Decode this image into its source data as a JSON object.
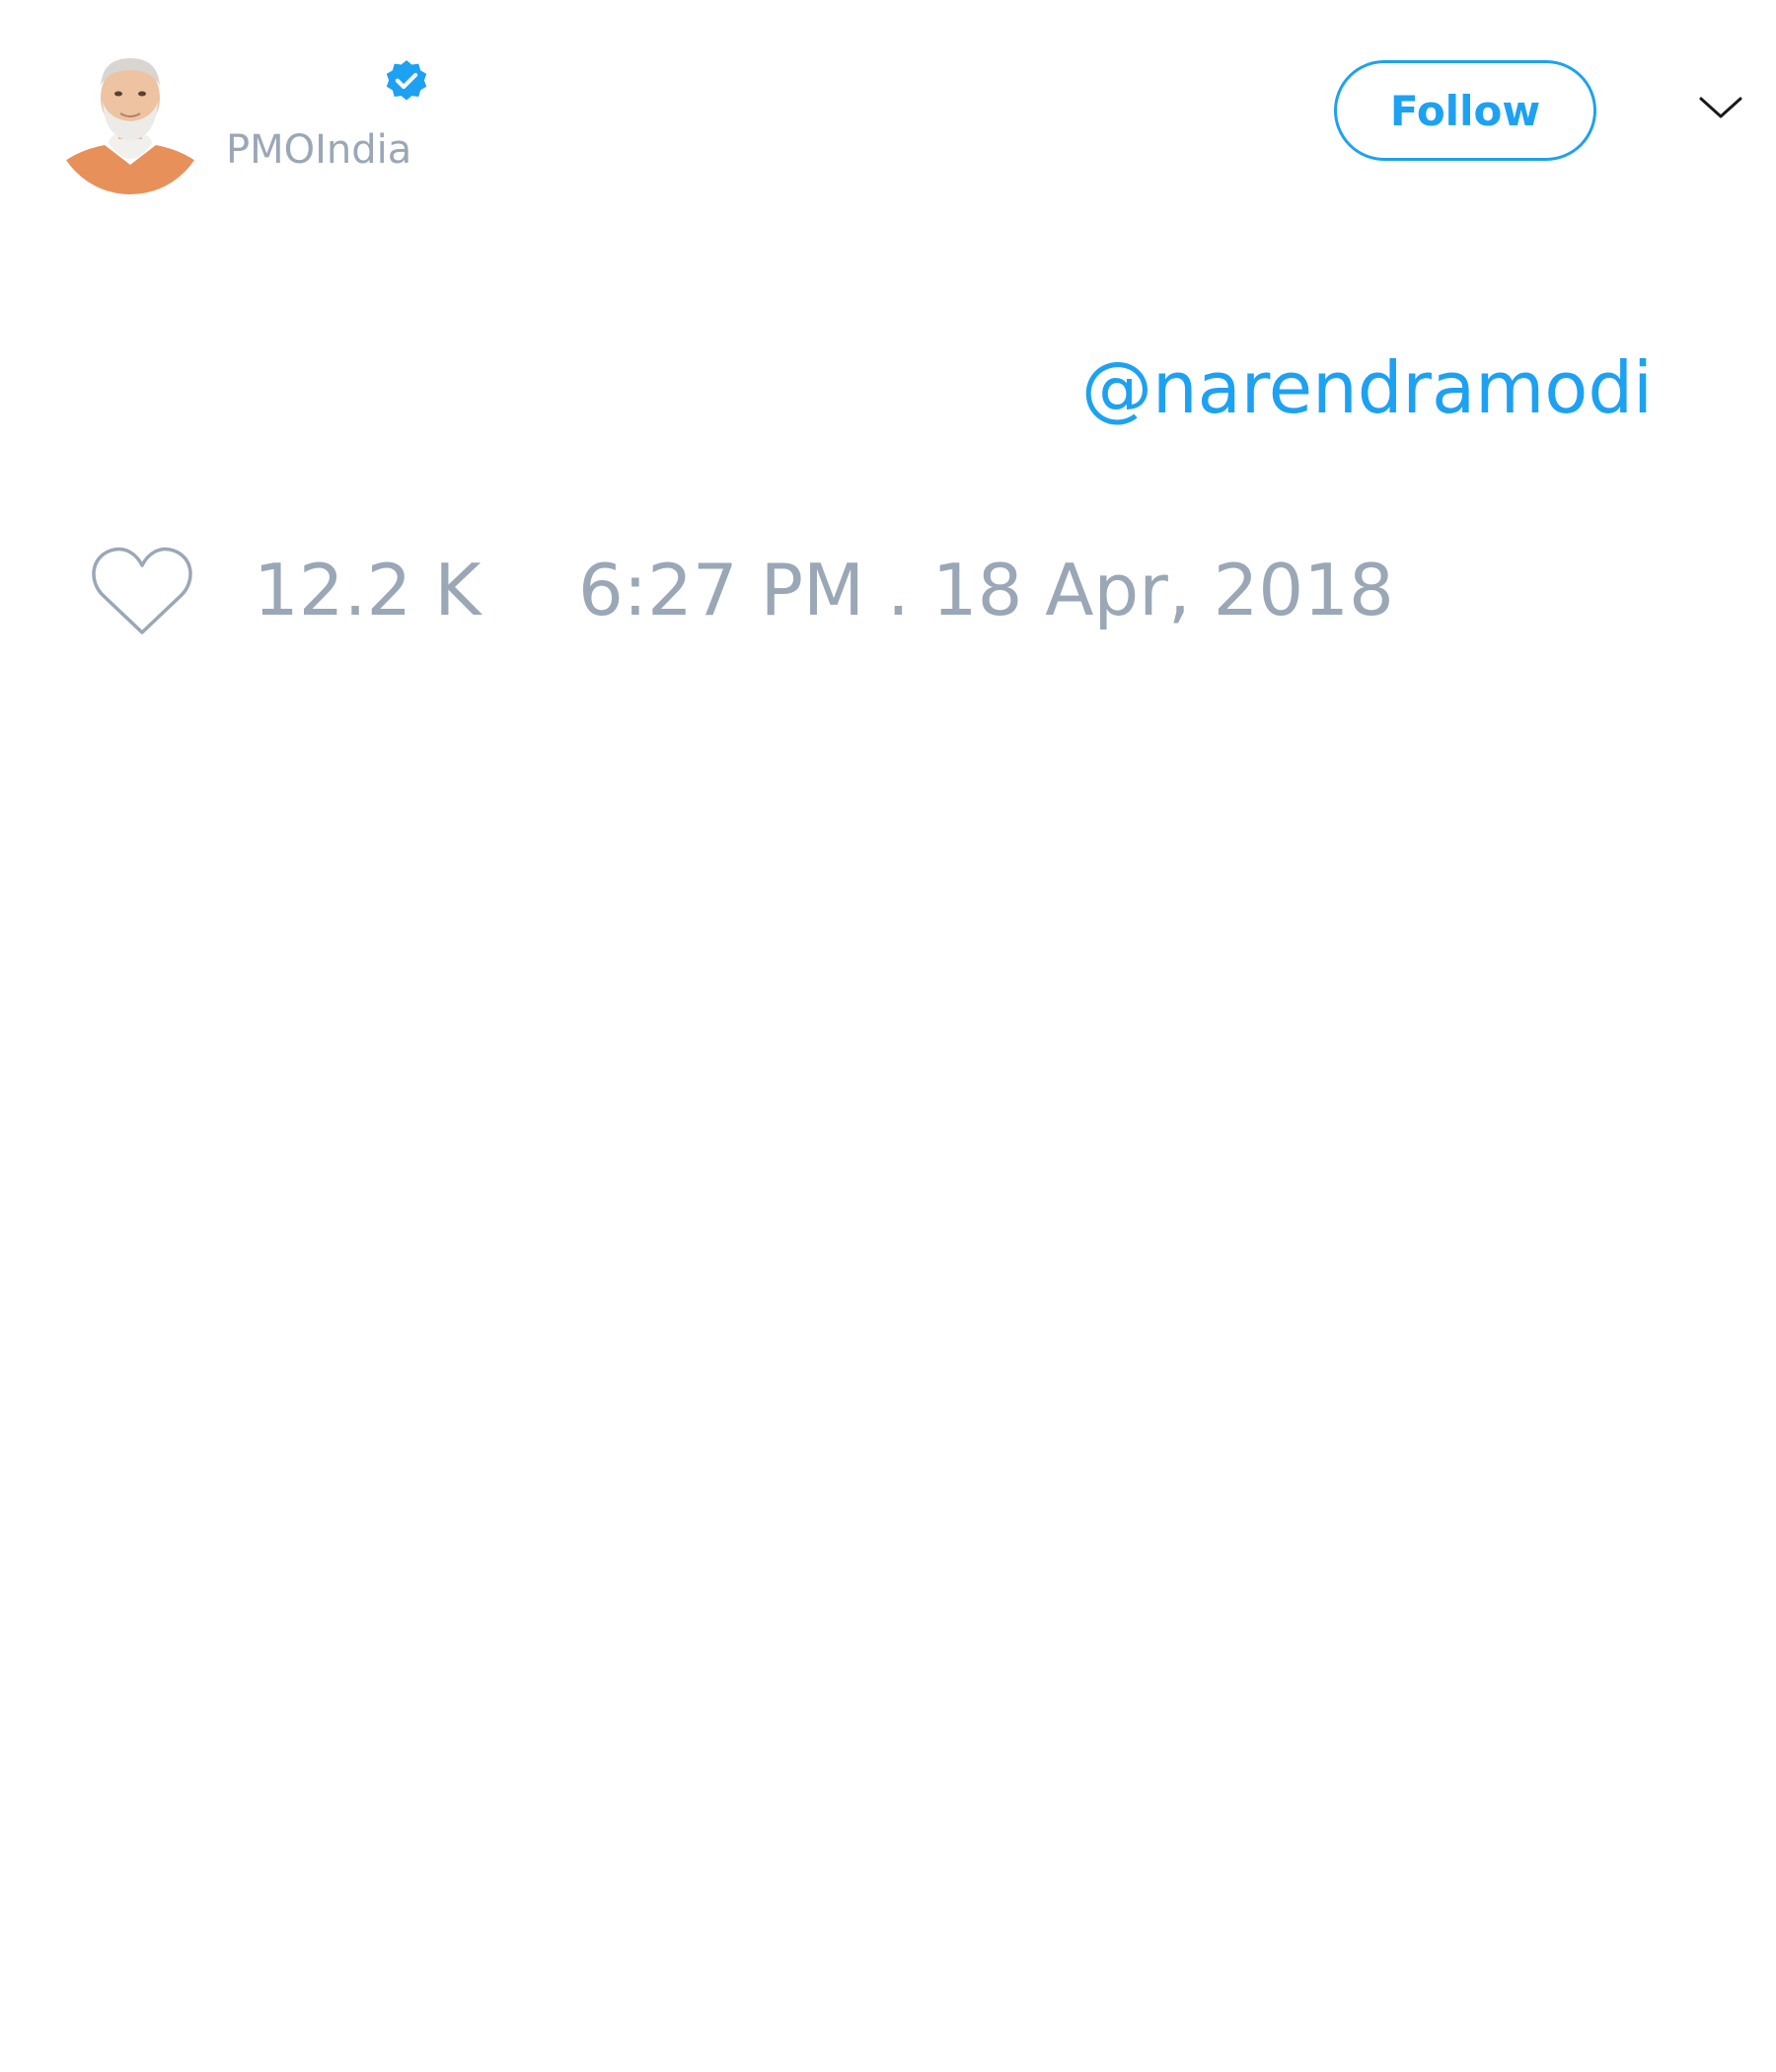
{
  "author": {
    "handle": "PMOIndia",
    "verified": true,
    "avatar_icon": "avatar-photo"
  },
  "header": {
    "follow_label": "Follow",
    "menu_icon": "chevron-down-icon"
  },
  "tweet": {
    "mention": "@narendramodi"
  },
  "footer": {
    "like_icon": "heart-outline-icon",
    "like_count": "12.2 K",
    "timestamp": "6:27 PM . 18 Apr, 2018"
  },
  "colors": {
    "accent": "#1da1f2",
    "muted_text": "#9aa7b6",
    "background": "#ffffff",
    "avatar_jacket": "#e8905a"
  }
}
